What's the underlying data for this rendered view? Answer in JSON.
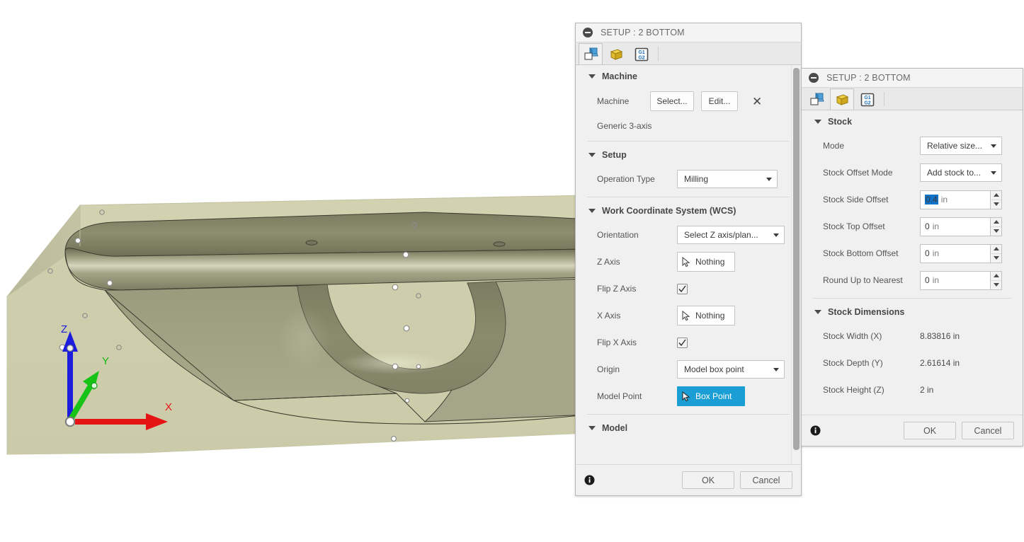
{
  "viewport": {
    "name": "cam-3d-viewport",
    "axes": [
      {
        "id": "z-axis",
        "label": "Z",
        "color": "#1c1cdd"
      },
      {
        "id": "y-axis",
        "label": "Y",
        "color": "#16c316"
      },
      {
        "id": "x-axis",
        "label": "X",
        "color": "#e51414"
      }
    ],
    "stock_color": "#cfcfad",
    "model_color": "#8f8f72"
  },
  "setup_dialog": {
    "title": "SETUP : 2 BOTTOM",
    "tabs": [
      {
        "name": "tab-setup",
        "icon": "setup-cube-icon",
        "active": true
      },
      {
        "name": "tab-stock",
        "icon": "stock-cube-icon",
        "active": false
      },
      {
        "name": "tab-post-process",
        "icon": "g-code-icon",
        "label": "G1 G2",
        "active": false
      }
    ],
    "sections": {
      "machine": {
        "heading": "Machine",
        "label": "Machine",
        "select_label": "Select...",
        "edit_label": "Edit...",
        "clear_label": "✕",
        "value": "Generic 3-axis"
      },
      "setup": {
        "heading": "Setup",
        "operation_type_label": "Operation Type",
        "operation_type_value": "Milling"
      },
      "wcs": {
        "heading": "Work Coordinate System (WCS)",
        "rows": [
          {
            "label": "Orientation",
            "type": "combo",
            "value": "Select Z axis/plan..."
          },
          {
            "label": "Z Axis",
            "type": "select",
            "value": "Nothing"
          },
          {
            "label": "Flip Z Axis",
            "type": "checkbox",
            "checked": true
          },
          {
            "label": "X Axis",
            "type": "select",
            "value": "Nothing"
          },
          {
            "label": "Flip X Axis",
            "type": "checkbox",
            "checked": true
          },
          {
            "label": "Origin",
            "type": "combo",
            "value": "Model box point"
          },
          {
            "label": "Model Point",
            "type": "select-blue",
            "value": "Box Point"
          }
        ]
      },
      "model": {
        "heading": "Model"
      }
    },
    "footer": {
      "ok_label": "OK",
      "cancel_label": "Cancel",
      "info_icon": "info-icon"
    }
  },
  "stock_dialog": {
    "title": "SETUP : 2 BOTTOM",
    "tabs": [
      {
        "name": "tab-setup",
        "icon": "setup-cube-icon",
        "active": false
      },
      {
        "name": "tab-stock",
        "icon": "stock-cube-icon",
        "active": true
      },
      {
        "name": "tab-post-process",
        "icon": "g-code-icon",
        "label": "G1 G2",
        "active": false
      }
    ],
    "sections": {
      "stock": {
        "heading": "Stock",
        "rows": [
          {
            "label": "Mode",
            "type": "combo",
            "value": "Relative size..."
          },
          {
            "label": "Stock Offset Mode",
            "type": "combo",
            "value": "Add stock to..."
          },
          {
            "label": "Stock Side Offset",
            "type": "spinner",
            "value": "0.4",
            "unit": "in",
            "selected": true
          },
          {
            "label": "Stock Top Offset",
            "type": "spinner",
            "value": "0",
            "unit": "in",
            "selected": false
          },
          {
            "label": "Stock Bottom Offset",
            "type": "spinner",
            "value": "0",
            "unit": "in",
            "selected": false
          },
          {
            "label": "Round Up to Nearest",
            "type": "spinner",
            "value": "0",
            "unit": "in",
            "selected": false
          }
        ]
      },
      "dimensions": {
        "heading": "Stock Dimensions",
        "rows": [
          {
            "label": "Stock Width (X)",
            "value": "8.83816 in"
          },
          {
            "label": "Stock Depth (Y)",
            "value": "2.61614 in"
          },
          {
            "label": "Stock Height (Z)",
            "value": "2 in"
          }
        ]
      }
    },
    "footer": {
      "ok_label": "OK",
      "cancel_label": "Cancel",
      "info_icon": "info-icon"
    }
  }
}
